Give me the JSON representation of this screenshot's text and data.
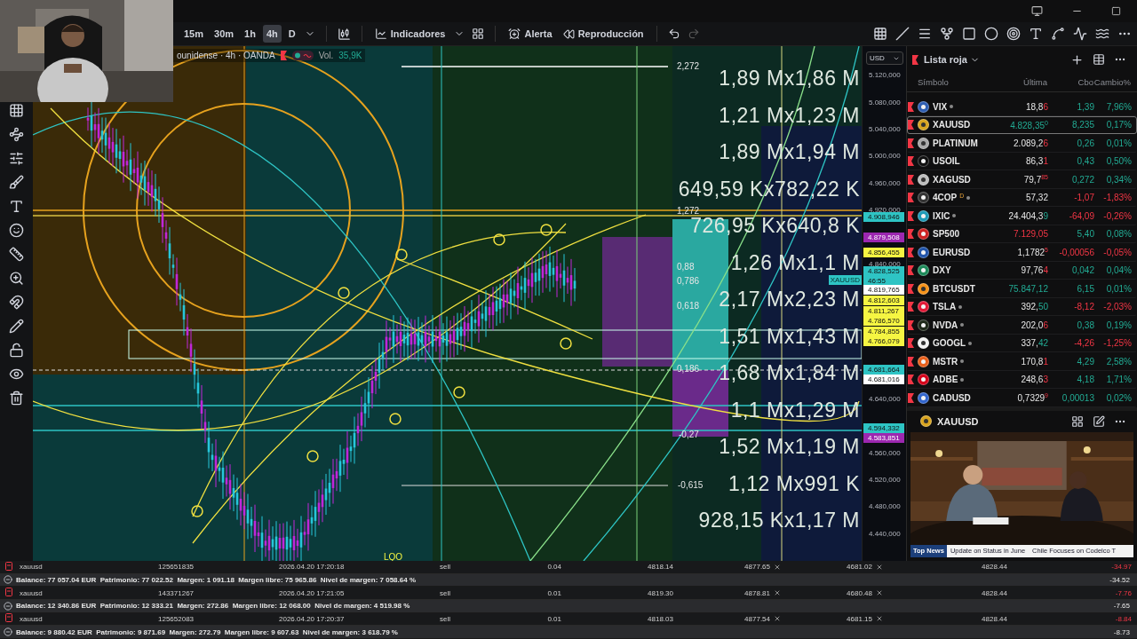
{
  "toolbar": {
    "timeframes": [
      {
        "label": "15m",
        "selected": false
      },
      {
        "label": "30m",
        "selected": false
      },
      {
        "label": "1h",
        "selected": false
      },
      {
        "label": "4h",
        "selected": true
      },
      {
        "label": "D",
        "selected": false
      }
    ],
    "indicators": "Indicadores",
    "alert": "Alerta",
    "replay": "Reproducción"
  },
  "chart": {
    "legend": {
      "symbol": "ounidense · 4h · OANDA",
      "volume_label": "Vol.",
      "volume_value": "35,9K"
    },
    "fib_levels": [
      "2,272",
      "1,272",
      "0,88",
      "0,786",
      "0,618",
      "0,186",
      "-0,27",
      "-0,615"
    ],
    "volume_profile": [
      "1,89 Mx1,86 M",
      "1,21 Mx1,23 M",
      "1,89 Mx1,94 M",
      "649,59 Kx782,22 K",
      "726,95 Kx640,8 K",
      "1,26 Mx1,1 M",
      "2,17 Mx2,23 M",
      "1,51 Mx1,43 M",
      "1,68 Mx1,84 M",
      "1,1 Mx1,29 M",
      "1,52 Mx1,19 M",
      "1,12 Mx991 K",
      "928,15 Kx1,17 M"
    ],
    "symbol_tag": "XAUUSD",
    "marker": "LQO"
  },
  "price_axis": {
    "currency": "USD",
    "ticks": [
      "5.120,000",
      "5.080,000",
      "5.040,000",
      "5.000,000",
      "4.960,000",
      "4.920,000",
      "4.840,000",
      "4.640,000",
      "4.560,000",
      "4.520,000",
      "4.480,000",
      "4.440,000"
    ],
    "tags": [
      {
        "price": "4.908,946",
        "color": "#2ec4c4"
      },
      {
        "price": "4.879,508",
        "color": "#9c27b0"
      },
      {
        "price": "4.856,455",
        "color": "#f5f542"
      },
      {
        "price": "4.828,525",
        "color": "#2ec4c4",
        "countdown": "46:55"
      },
      {
        "price": "4.819,765",
        "color": "#ffffff"
      },
      {
        "price": "4.812,603",
        "color": "#f5f542"
      },
      {
        "price": "4.811,267",
        "color": "#f5f542"
      },
      {
        "price": "4.786,570",
        "color": "#f5f542"
      },
      {
        "price": "4.784,855",
        "color": "#f5f542"
      },
      {
        "price": "4.766,079",
        "color": "#f5f542"
      },
      {
        "price": "4.681,664",
        "color": "#2ec4c4"
      },
      {
        "price": "4.681,016",
        "color": "#ffffff"
      },
      {
        "price": "4.594,332",
        "color": "#2ec4c4"
      },
      {
        "price": "4.583,851",
        "color": "#9c27b0"
      }
    ]
  },
  "watchlist": {
    "title": "Lista roja",
    "columns": [
      "Símbolo",
      "Última",
      "Cbo",
      "Cambio%"
    ],
    "rows": [
      {
        "symbol": "VIX",
        "color": "#2f5fb3",
        "dot": true,
        "last": "18,8",
        "tail": "6",
        "tail_raised": false,
        "tail_rising": false,
        "last_rising": false,
        "last_falling": false,
        "change": "1,39",
        "percent": "7,96%",
        "rising": true,
        "selected": false
      },
      {
        "symbol": "XAUUSD",
        "color": "#d9a520",
        "dot": false,
        "last": "4.828,35",
        "tail": "0",
        "tail_raised": true,
        "tail_rising": true,
        "last_rising": true,
        "last_falling": false,
        "change": "8,235",
        "percent": "0,17%",
        "rising": true,
        "selected": true
      },
      {
        "symbol": "PLATINUM",
        "color": "#a8a8a8",
        "dot": false,
        "last": "2.089,2",
        "tail": "6",
        "tail_raised": false,
        "tail_rising": false,
        "last_rising": false,
        "last_falling": false,
        "change": "0,26",
        "percent": "0,01%",
        "rising": true,
        "selected": false
      },
      {
        "symbol": "USOIL",
        "color": "#111111",
        "dot": false,
        "last": "86,3",
        "tail": "1",
        "tail_raised": false,
        "tail_rising": false,
        "last_rising": false,
        "last_falling": false,
        "change": "0,43",
        "percent": "0,50%",
        "rising": true,
        "selected": false
      },
      {
        "symbol": "XAGUSD",
        "color": "#bdbdbd",
        "dot": false,
        "last": "79,7",
        "tail": "85",
        "tail_raised": true,
        "tail_rising": false,
        "last_rising": false,
        "last_falling": false,
        "change": "0,272",
        "percent": "0,34%",
        "rising": true,
        "selected": false
      },
      {
        "symbol": "4COP",
        "color": "#333333",
        "dot": true,
        "badge": "D",
        "last": "57,32",
        "last_rising": false,
        "last_falling": false,
        "change": "-1,07",
        "percent": "-1,83%",
        "rising": false,
        "selected": false
      },
      {
        "symbol": "IXIC",
        "color": "#1e9bb8",
        "dot": true,
        "last": "24.404,3",
        "tail": "9",
        "tail_raised": false,
        "tail_rising": true,
        "last_rising": false,
        "last_falling": false,
        "change": "-64,09",
        "percent": "-0,26%",
        "rising": false,
        "selected": false
      },
      {
        "symbol": "SP500",
        "color": "#cc2222",
        "dot": false,
        "last": "7.129,05",
        "last_rising": false,
        "last_falling": true,
        "change": "5,40",
        "percent": "0,08%",
        "rising": true,
        "selected": false
      },
      {
        "symbol": "EURUSD",
        "color": "#2255aa",
        "dot": false,
        "last": "1,1782",
        "tail": "5",
        "tail_raised": true,
        "tail_rising": false,
        "last_rising": false,
        "last_falling": false,
        "change": "-0,00056",
        "percent": "-0,05%",
        "rising": false,
        "selected": false
      },
      {
        "symbol": "DXY",
        "color": "#1e8a5a",
        "dot": false,
        "last": "97,76",
        "tail": "4",
        "tail_raised": false,
        "tail_rising": false,
        "last_rising": false,
        "last_falling": false,
        "change": "0,042",
        "percent": "0,04%",
        "rising": true,
        "selected": false
      },
      {
        "symbol": "BTCUSDT",
        "color": "#f7931a",
        "dot": false,
        "last": "75.847,12",
        "last_rising": true,
        "last_falling": false,
        "change": "6,15",
        "percent": "0,01%",
        "rising": true,
        "selected": false
      },
      {
        "symbol": "TSLA",
        "color": "#e31937",
        "dot": true,
        "last": "392,",
        "tail": "50",
        "tail_raised": false,
        "tail_rising": true,
        "last_rising": false,
        "last_falling": false,
        "change": "-8,12",
        "percent": "-2,03%",
        "rising": false,
        "selected": false
      },
      {
        "symbol": "NVDA",
        "color": "#1f2a1a",
        "dot": true,
        "last": "202,0",
        "tail": "6",
        "tail_raised": false,
        "tail_rising": false,
        "last_rising": false,
        "last_falling": false,
        "change": "0,38",
        "percent": "0,19%",
        "rising": true,
        "selected": false
      },
      {
        "symbol": "GOOGL",
        "color": "#f1f1f1",
        "dot": true,
        "last": "337,",
        "tail": "42",
        "tail_raised": false,
        "tail_rising": true,
        "last_rising": false,
        "last_falling": false,
        "change": "-4,26",
        "percent": "-1,25%",
        "rising": false,
        "selected": false
      },
      {
        "symbol": "MSTR",
        "color": "#e8601c",
        "dot": true,
        "last": "170,8",
        "tail": "1",
        "tail_raised": false,
        "tail_rising": false,
        "last_rising": false,
        "last_falling": false,
        "change": "4,29",
        "percent": "2,58%",
        "rising": true,
        "selected": false
      },
      {
        "symbol": "ADBE",
        "color": "#d4001a",
        "dot": true,
        "last": "248,6",
        "tail": "3",
        "tail_raised": false,
        "tail_rising": false,
        "last_rising": false,
        "last_falling": false,
        "change": "4,18",
        "percent": "1,71%",
        "rising": true,
        "selected": false
      },
      {
        "symbol": "CADUSD",
        "color": "#3366cc",
        "dot": false,
        "last": "0,7329",
        "tail": "9",
        "tail_raised": true,
        "tail_rising": false,
        "last_rising": false,
        "last_falling": false,
        "change": "0,00013",
        "percent": "0,02%",
        "rising": true,
        "selected": false
      }
    ]
  },
  "detail": {
    "symbol": "XAUUSD",
    "news_label": "Top News",
    "headlines": [
      "Update on Status in June",
      "Chile Focuses on Codelco T"
    ]
  },
  "positions": [
    {
      "symbol": "xauusd",
      "ticket": "125651835",
      "time": "2026.04.20 17:20:18",
      "side": "sell",
      "volume": "0.04",
      "open": "4818.14",
      "stop_loss": "4877.65",
      "take_profit": "4681.02",
      "price": "4828.44",
      "profit": "-34.97",
      "loss": true,
      "balance": "Balance: 77 057.04 EUR  Patrimonio: 77 022.52  Margen: 1 091.18  Margen libre: 75 965.86  Nivel de margen: 7 058.64 %",
      "total": "-34.52"
    },
    {
      "symbol": "xauusd",
      "ticket": "143371267",
      "time": "2026.04.20 17:21:05",
      "side": "sell",
      "volume": "0.01",
      "open": "4819.30",
      "stop_loss": "4878.81",
      "take_profit": "4680.48",
      "price": "4828.44",
      "profit": "-7.76",
      "loss": true,
      "balance": "Balance: 12 340.86 EUR  Patrimonio: 12 333.21  Margen: 272.86  Margen libre: 12 068.00  Nivel de margen: 4 519.98 %",
      "total": "-7.65"
    },
    {
      "symbol": "xauusd",
      "ticket": "125652083",
      "time": "2026.04.20 17:20:37",
      "side": "sell",
      "volume": "0.01",
      "open": "4818.03",
      "stop_loss": "4877.54",
      "take_profit": "4681.15",
      "price": "4828.44",
      "profit": "-8.84",
      "loss": true,
      "balance": "Balance: 9 880.42 EUR  Patrimonio: 9 871.69  Margen: 272.79  Margen libre: 9 607.63  Nivel de margen: 3 618.79 %",
      "total": "-8.73"
    }
  ]
}
